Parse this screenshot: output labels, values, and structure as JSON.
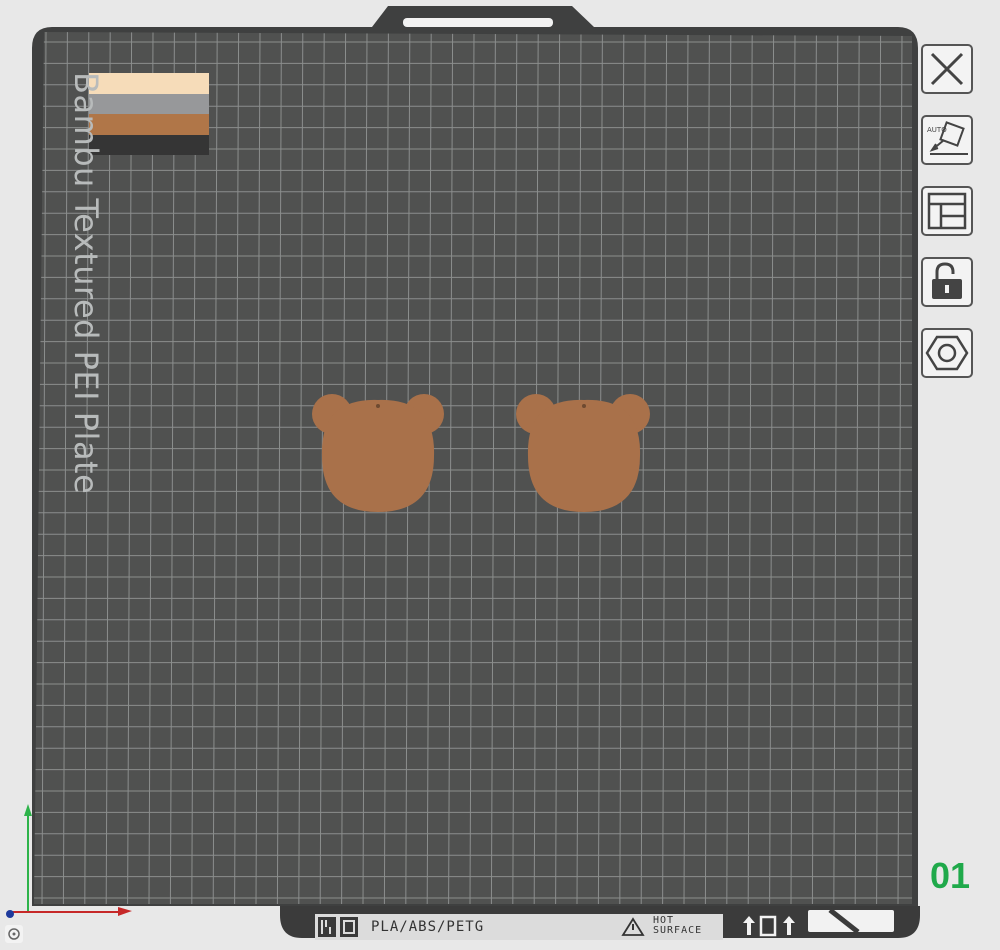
{
  "plate": {
    "name": "Bambu Textured PEI Plate",
    "number": "01",
    "surface_color": "#505150",
    "grid_color": "#8b8e8d"
  },
  "filament_swatches": [
    {
      "color": "#f6dcb9"
    },
    {
      "color": "#97989a"
    },
    {
      "color": "#b07648"
    },
    {
      "color": "#353535"
    }
  ],
  "objects": [
    {
      "name": "bear-head-left",
      "color": "#a9714a"
    },
    {
      "name": "bear-head-right",
      "color": "#a9714a"
    }
  ],
  "toolbar": {
    "close": {
      "icon": "close-icon"
    },
    "auto_orient": {
      "icon": "auto-orient-icon",
      "label": "AUTO"
    },
    "arrange": {
      "icon": "arrange-icon"
    },
    "lock": {
      "icon": "unlock-icon"
    },
    "settings": {
      "icon": "hex-nut-icon"
    }
  },
  "bottom_label": {
    "filaments": "PLA/ABS/PETG",
    "hot_line1": "HOT",
    "hot_line2": "SURFACE"
  },
  "axes": {
    "x_color": "#c62828",
    "y_color": "#2db34a",
    "z_color": "#1e3a9c"
  }
}
